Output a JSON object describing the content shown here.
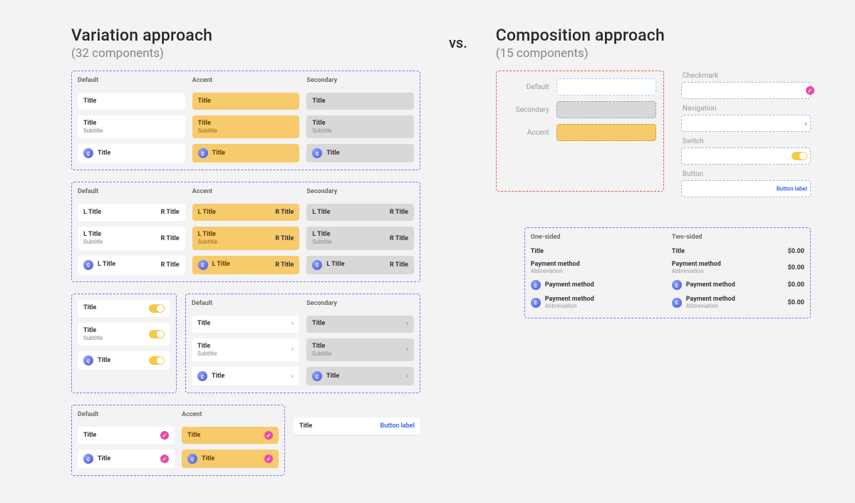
{
  "vs": "vs.",
  "left": {
    "title": "Variation approach",
    "count": "(32 components)"
  },
  "right": {
    "title": "Composition approach",
    "count": "(15 components)"
  },
  "cols": {
    "default": "Default",
    "accent": "Accent",
    "secondary": "Secondary"
  },
  "lbl": {
    "title": "Title",
    "subtitle": "Subtitle",
    "ltitle": "L Title",
    "rtitle": "R Title",
    "buttonLabel": "Button label"
  },
  "comp": {
    "checkmark": "Checkmark",
    "navigation": "Navigation",
    "switch": "Switch",
    "button": "Button"
  },
  "list": {
    "one": "One-sided",
    "two": "Two-sided",
    "title": "Title",
    "pm": "Payment method",
    "abbr": "Abbreviation",
    "amt": "$0.00"
  }
}
